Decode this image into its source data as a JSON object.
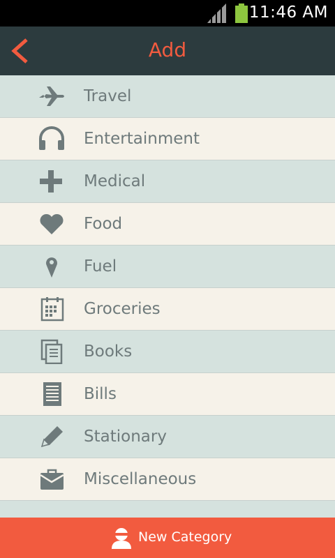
{
  "status_bar": {
    "time": "11:46 AM"
  },
  "header": {
    "title": "Add"
  },
  "categories": [
    {
      "label": "Travel",
      "icon": "airplane-icon"
    },
    {
      "label": "Entertainment",
      "icon": "headphones-icon"
    },
    {
      "label": "Medical",
      "icon": "medical-cross-icon"
    },
    {
      "label": "Food",
      "icon": "heart-icon"
    },
    {
      "label": "Fuel",
      "icon": "location-pin-icon"
    },
    {
      "label": "Groceries",
      "icon": "calendar-grid-icon"
    },
    {
      "label": "Books",
      "icon": "books-icon"
    },
    {
      "label": "Bills",
      "icon": "bill-document-icon"
    },
    {
      "label": "Stationary",
      "icon": "pencil-icon"
    },
    {
      "label": "Miscellaneous",
      "icon": "briefcase-icon"
    }
  ],
  "footer": {
    "button_label": "New Category",
    "icon": "user-avatar-icon"
  },
  "colors": {
    "accent": "#f25b3f",
    "header_bg": "#2c3b3e",
    "row_a": "#d5e2de",
    "row_b": "#f6f2e9",
    "icon": "#6e7a7b"
  }
}
